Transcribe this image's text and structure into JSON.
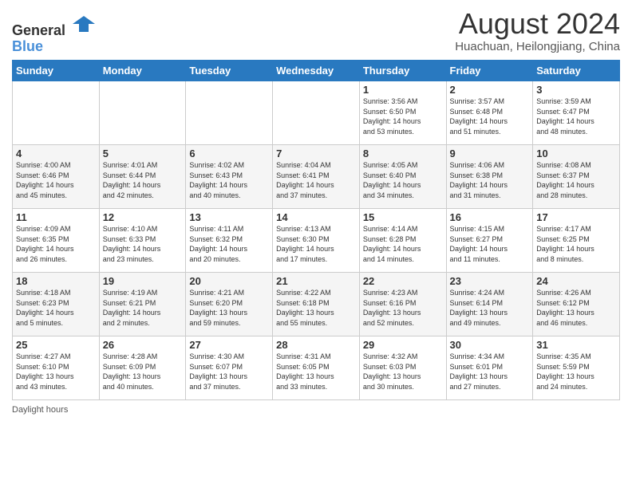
{
  "header": {
    "logo_line1": "General",
    "logo_line2": "Blue",
    "title": "August 2024",
    "subtitle": "Huachuan, Heilongjiang, China"
  },
  "days_of_week": [
    "Sunday",
    "Monday",
    "Tuesday",
    "Wednesday",
    "Thursday",
    "Friday",
    "Saturday"
  ],
  "weeks": [
    [
      {
        "day": "",
        "info": ""
      },
      {
        "day": "",
        "info": ""
      },
      {
        "day": "",
        "info": ""
      },
      {
        "day": "",
        "info": ""
      },
      {
        "day": "1",
        "info": "Sunrise: 3:56 AM\nSunset: 6:50 PM\nDaylight: 14 hours\nand 53 minutes."
      },
      {
        "day": "2",
        "info": "Sunrise: 3:57 AM\nSunset: 6:48 PM\nDaylight: 14 hours\nand 51 minutes."
      },
      {
        "day": "3",
        "info": "Sunrise: 3:59 AM\nSunset: 6:47 PM\nDaylight: 14 hours\nand 48 minutes."
      }
    ],
    [
      {
        "day": "4",
        "info": "Sunrise: 4:00 AM\nSunset: 6:46 PM\nDaylight: 14 hours\nand 45 minutes."
      },
      {
        "day": "5",
        "info": "Sunrise: 4:01 AM\nSunset: 6:44 PM\nDaylight: 14 hours\nand 42 minutes."
      },
      {
        "day": "6",
        "info": "Sunrise: 4:02 AM\nSunset: 6:43 PM\nDaylight: 14 hours\nand 40 minutes."
      },
      {
        "day": "7",
        "info": "Sunrise: 4:04 AM\nSunset: 6:41 PM\nDaylight: 14 hours\nand 37 minutes."
      },
      {
        "day": "8",
        "info": "Sunrise: 4:05 AM\nSunset: 6:40 PM\nDaylight: 14 hours\nand 34 minutes."
      },
      {
        "day": "9",
        "info": "Sunrise: 4:06 AM\nSunset: 6:38 PM\nDaylight: 14 hours\nand 31 minutes."
      },
      {
        "day": "10",
        "info": "Sunrise: 4:08 AM\nSunset: 6:37 PM\nDaylight: 14 hours\nand 28 minutes."
      }
    ],
    [
      {
        "day": "11",
        "info": "Sunrise: 4:09 AM\nSunset: 6:35 PM\nDaylight: 14 hours\nand 26 minutes."
      },
      {
        "day": "12",
        "info": "Sunrise: 4:10 AM\nSunset: 6:33 PM\nDaylight: 14 hours\nand 23 minutes."
      },
      {
        "day": "13",
        "info": "Sunrise: 4:11 AM\nSunset: 6:32 PM\nDaylight: 14 hours\nand 20 minutes."
      },
      {
        "day": "14",
        "info": "Sunrise: 4:13 AM\nSunset: 6:30 PM\nDaylight: 14 hours\nand 17 minutes."
      },
      {
        "day": "15",
        "info": "Sunrise: 4:14 AM\nSunset: 6:28 PM\nDaylight: 14 hours\nand 14 minutes."
      },
      {
        "day": "16",
        "info": "Sunrise: 4:15 AM\nSunset: 6:27 PM\nDaylight: 14 hours\nand 11 minutes."
      },
      {
        "day": "17",
        "info": "Sunrise: 4:17 AM\nSunset: 6:25 PM\nDaylight: 14 hours\nand 8 minutes."
      }
    ],
    [
      {
        "day": "18",
        "info": "Sunrise: 4:18 AM\nSunset: 6:23 PM\nDaylight: 14 hours\nand 5 minutes."
      },
      {
        "day": "19",
        "info": "Sunrise: 4:19 AM\nSunset: 6:21 PM\nDaylight: 14 hours\nand 2 minutes."
      },
      {
        "day": "20",
        "info": "Sunrise: 4:21 AM\nSunset: 6:20 PM\nDaylight: 13 hours\nand 59 minutes."
      },
      {
        "day": "21",
        "info": "Sunrise: 4:22 AM\nSunset: 6:18 PM\nDaylight: 13 hours\nand 55 minutes."
      },
      {
        "day": "22",
        "info": "Sunrise: 4:23 AM\nSunset: 6:16 PM\nDaylight: 13 hours\nand 52 minutes."
      },
      {
        "day": "23",
        "info": "Sunrise: 4:24 AM\nSunset: 6:14 PM\nDaylight: 13 hours\nand 49 minutes."
      },
      {
        "day": "24",
        "info": "Sunrise: 4:26 AM\nSunset: 6:12 PM\nDaylight: 13 hours\nand 46 minutes."
      }
    ],
    [
      {
        "day": "25",
        "info": "Sunrise: 4:27 AM\nSunset: 6:10 PM\nDaylight: 13 hours\nand 43 minutes."
      },
      {
        "day": "26",
        "info": "Sunrise: 4:28 AM\nSunset: 6:09 PM\nDaylight: 13 hours\nand 40 minutes."
      },
      {
        "day": "27",
        "info": "Sunrise: 4:30 AM\nSunset: 6:07 PM\nDaylight: 13 hours\nand 37 minutes."
      },
      {
        "day": "28",
        "info": "Sunrise: 4:31 AM\nSunset: 6:05 PM\nDaylight: 13 hours\nand 33 minutes."
      },
      {
        "day": "29",
        "info": "Sunrise: 4:32 AM\nSunset: 6:03 PM\nDaylight: 13 hours\nand 30 minutes."
      },
      {
        "day": "30",
        "info": "Sunrise: 4:34 AM\nSunset: 6:01 PM\nDaylight: 13 hours\nand 27 minutes."
      },
      {
        "day": "31",
        "info": "Sunrise: 4:35 AM\nSunset: 5:59 PM\nDaylight: 13 hours\nand 24 minutes."
      }
    ]
  ],
  "footer": {
    "note": "Daylight hours"
  }
}
